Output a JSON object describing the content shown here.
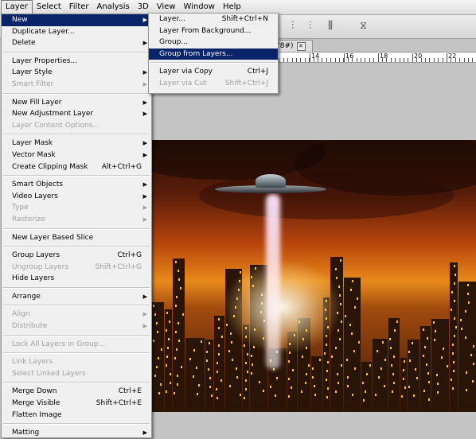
{
  "menubar": {
    "items": [
      "Layer",
      "Select",
      "Filter",
      "Analysis",
      "3D",
      "View",
      "Window",
      "Help"
    ]
  },
  "document": {
    "tab_label": "78#)",
    "ruler_labels": [
      "14",
      "16",
      "18",
      "20",
      "22"
    ]
  },
  "layer_menu": {
    "groups": [
      [
        {
          "label": "New",
          "submenu": true,
          "state": "hi"
        },
        {
          "label": "Duplicate Layer..."
        },
        {
          "label": "Delete",
          "submenu": true
        }
      ],
      [
        {
          "label": "Layer Properties..."
        },
        {
          "label": "Layer Style",
          "submenu": true
        },
        {
          "label": "Smart Filter",
          "submenu": true,
          "state": "dis"
        }
      ],
      [
        {
          "label": "New Fill Layer",
          "submenu": true
        },
        {
          "label": "New Adjustment Layer",
          "submenu": true
        },
        {
          "label": "Layer Content Options...",
          "state": "dis"
        }
      ],
      [
        {
          "label": "Layer Mask",
          "submenu": true
        },
        {
          "label": "Vector Mask",
          "submenu": true
        },
        {
          "label": "Create Clipping Mask",
          "shortcut": "Alt+Ctrl+G"
        }
      ],
      [
        {
          "label": "Smart Objects",
          "submenu": true
        },
        {
          "label": "Video Layers",
          "submenu": true
        },
        {
          "label": "Type",
          "submenu": true,
          "state": "dis"
        },
        {
          "label": "Rasterize",
          "submenu": true,
          "state": "dis"
        }
      ],
      [
        {
          "label": "New Layer Based Slice"
        }
      ],
      [
        {
          "label": "Group Layers",
          "shortcut": "Ctrl+G"
        },
        {
          "label": "Ungroup Layers",
          "shortcut": "Shift+Ctrl+G",
          "state": "dis"
        },
        {
          "label": "Hide Layers"
        }
      ],
      [
        {
          "label": "Arrange",
          "submenu": true
        }
      ],
      [
        {
          "label": "Align",
          "submenu": true,
          "state": "dis"
        },
        {
          "label": "Distribute",
          "submenu": true,
          "state": "dis"
        }
      ],
      [
        {
          "label": "Lock All Layers in Group...",
          "state": "dis"
        }
      ],
      [
        {
          "label": "Link Layers",
          "state": "dis"
        },
        {
          "label": "Select Linked Layers",
          "state": "dis"
        }
      ],
      [
        {
          "label": "Merge Down",
          "shortcut": "Ctrl+E"
        },
        {
          "label": "Merge Visible",
          "shortcut": "Shift+Ctrl+E"
        },
        {
          "label": "Flatten Image"
        }
      ],
      [
        {
          "label": "Matting",
          "submenu": true
        }
      ]
    ]
  },
  "new_submenu": {
    "groups": [
      [
        {
          "label": "Layer...",
          "shortcut": "Shift+Ctrl+N"
        },
        {
          "label": "Layer From Background..."
        },
        {
          "label": "Group..."
        },
        {
          "label": "Group from Layers...",
          "state": "hi"
        }
      ],
      [
        {
          "label": "Layer via Copy",
          "shortcut": "Ctrl+J"
        },
        {
          "label": "Layer via Cut",
          "shortcut": "Shift+Ctrl+J",
          "state": "dis"
        }
      ]
    ]
  },
  "colors": {
    "highlight": "#0a246a",
    "disabled": "#a0a0a0",
    "menu_bg": "#f0f0f0"
  }
}
